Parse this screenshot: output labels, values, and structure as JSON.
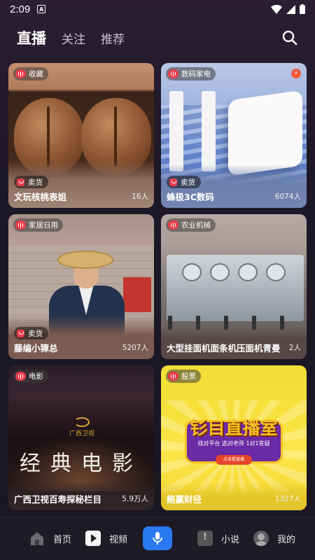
{
  "status_bar": {
    "time": "2:09",
    "notification_icon": "A"
  },
  "top_nav": {
    "tabs": [
      {
        "label": "直播",
        "active": true
      },
      {
        "label": "关注",
        "active": false
      },
      {
        "label": "推荐",
        "active": false
      }
    ],
    "search_icon": "search-icon"
  },
  "cards": [
    {
      "category": "收藏",
      "has_sell_badge": true,
      "sell_label": "卖货",
      "name": "文玩核桃表姐",
      "viewers": "16人"
    },
    {
      "category": "数码家电",
      "has_sell_badge": true,
      "sell_label": "卖货",
      "name": "蜂极3C数码",
      "viewers": "6074人",
      "hot_icon": "fire-icon"
    },
    {
      "category": "家居日用",
      "has_sell_badge": true,
      "sell_label": "卖货",
      "name": "藤编小獐总",
      "viewers": "5207人"
    },
    {
      "category": "农业机械",
      "has_sell_badge": false,
      "name": "大型挂面机面条机压面机青曼",
      "viewers": "2人"
    },
    {
      "category": "电影",
      "has_sell_badge": false,
      "name": "广西卫视百寿探秘栏目",
      "viewers": "5.9万人",
      "overlay_text": "经典电影",
      "overlay_logo": "广西卫视"
    },
    {
      "category": "股票",
      "has_sell_badge": false,
      "name": "鲍赢财径",
      "viewers": "1327人",
      "overlay_text": "钐目直播室",
      "overlay_sub": "找对平台 选对老师 1对1答疑",
      "overlay_pill": "点击看直播"
    }
  ],
  "bottom_nav": {
    "items": [
      {
        "label": "首页",
        "icon": "home-icon"
      },
      {
        "label": "视频",
        "icon": "video-play-icon"
      },
      {
        "label": "",
        "icon": "microphone-icon"
      },
      {
        "label": "小说",
        "icon": "book-icon"
      },
      {
        "label": "我的",
        "icon": "profile-avatar-icon"
      }
    ]
  },
  "colors": {
    "accent_red": "#e83c4b",
    "mic_blue": "#2b79f2",
    "background": "#1c1626"
  }
}
